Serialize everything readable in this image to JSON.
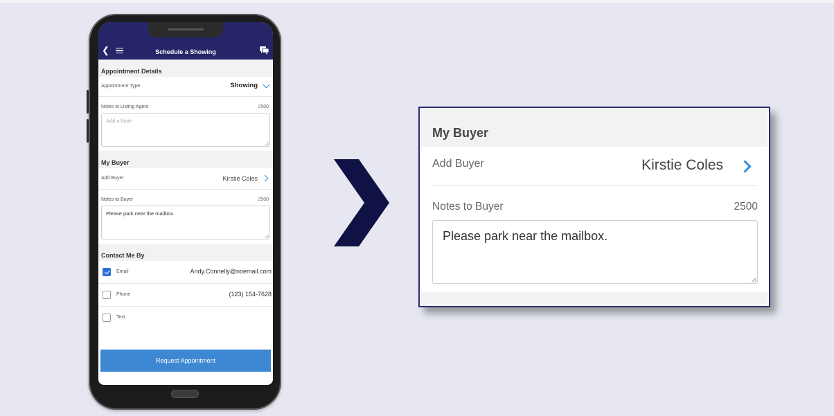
{
  "phone": {
    "header": {
      "title": "Schedule a Showing"
    },
    "appointment_details": {
      "heading": "Appointment Details",
      "type_label": "Appointment Type",
      "type_value": "Showing",
      "notes_label": "Notes to Listing Agent",
      "notes_count": "2500",
      "notes_placeholder": "Add a Note"
    },
    "my_buyer": {
      "heading": "My Buyer",
      "add_label": "Add Buyer",
      "buyer_name": "Kirstie Coles",
      "notes_label": "Notes to Buyer",
      "notes_count": "2500",
      "notes_value": "Please park near the mailbox."
    },
    "contact": {
      "heading": "Contact Me By",
      "items": [
        {
          "label": "Email",
          "value": "Andy.Connelly@noemail.com",
          "checked": true
        },
        {
          "label": "Phone",
          "value": "(123) 154-7628",
          "checked": false
        },
        {
          "label": "Text",
          "value": "",
          "checked": false
        }
      ]
    },
    "request_button": "Request Appointment"
  },
  "zoom": {
    "heading": "My Buyer",
    "add_label": "Add Buyer",
    "buyer_name": "Kirstie Coles",
    "notes_label": "Notes to Buyer",
    "notes_count": "2500",
    "notes_value": "Please park near the mailbox."
  },
  "colors": {
    "header_bg": "#252567",
    "accent_blue": "#2f8ee0",
    "button_bg": "#3e87d2",
    "checkbox_checked": "#2f6fd6",
    "arrow": "#101245",
    "page_bg": "#e6e7f1"
  },
  "icons": [
    "back-arrow-icon",
    "hamburger-menu-icon",
    "chat-icon",
    "chevron-down-icon",
    "chevron-right-icon",
    "checkbox-icon"
  ]
}
